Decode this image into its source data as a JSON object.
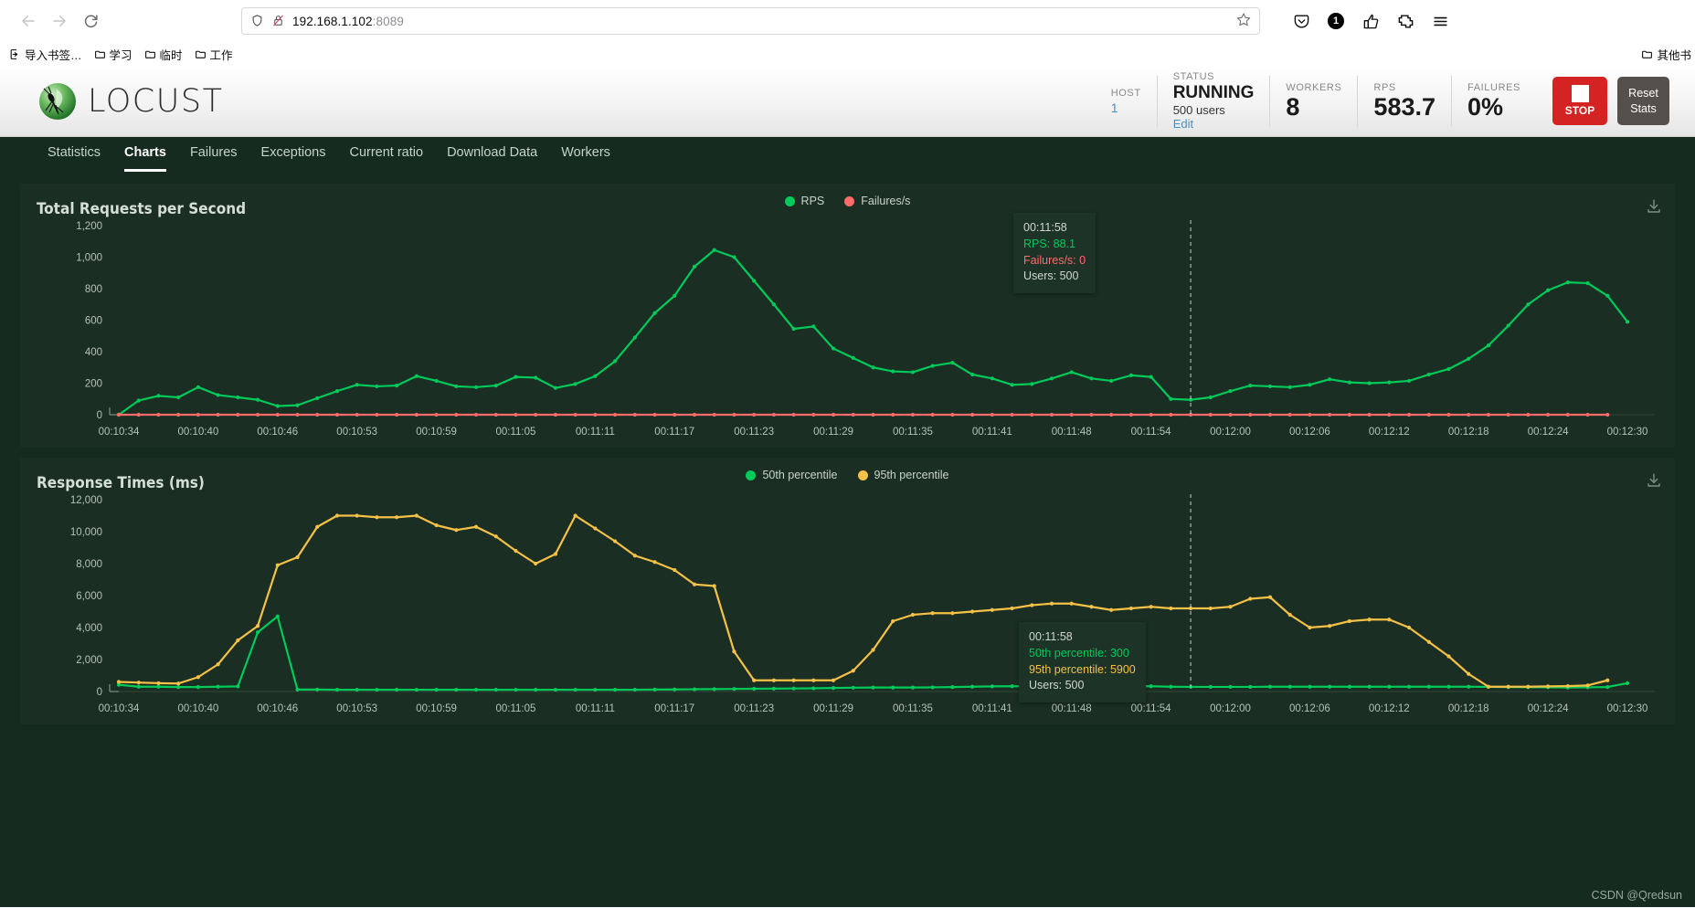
{
  "browser": {
    "back_icon": "back-arrow",
    "forward_icon": "forward-arrow",
    "reload_icon": "reload",
    "url": "192.168.1.102",
    "url_port": ":8089",
    "url_full": "192.168.1.102:8089",
    "bookmark_star": "star-icon",
    "toolbar_icons": [
      "pocket-icon",
      "notification-badge",
      "share-icon",
      "extensions-icon",
      "menu-icon"
    ],
    "notification_count": "1",
    "bookmarks": [
      {
        "label": "导入书签…",
        "icon": "import-bookmarks-icon"
      },
      {
        "label": "学习",
        "icon": "folder-icon"
      },
      {
        "label": "临时",
        "icon": "folder-icon"
      },
      {
        "label": "工作",
        "icon": "folder-icon"
      }
    ],
    "bookmarks_right": {
      "label": "其他书",
      "icon": "folder-icon"
    }
  },
  "header": {
    "brand": "LOCUST",
    "stats": [
      {
        "label": "HOST",
        "value": "1",
        "type": "link"
      },
      {
        "label": "STATUS",
        "value": "RUNNING",
        "sub": "500 users",
        "edit": "Edit"
      },
      {
        "label": "WORKERS",
        "value": "8"
      },
      {
        "label": "RPS",
        "value": "583.7"
      },
      {
        "label": "FAILURES",
        "value": "0%"
      }
    ],
    "stop_button": "STOP",
    "reset_button_line1": "Reset",
    "reset_button_line2": "Stats",
    "colors": {
      "stop": "#d32323",
      "reset": "#56504c",
      "link": "#4a90c4"
    }
  },
  "tabs": [
    {
      "label": "Statistics",
      "active": false
    },
    {
      "label": "Charts",
      "active": true
    },
    {
      "label": "Failures",
      "active": false
    },
    {
      "label": "Exceptions",
      "active": false
    },
    {
      "label": "Current ratio",
      "active": false
    },
    {
      "label": "Download Data",
      "active": false
    },
    {
      "label": "Workers",
      "active": false
    }
  ],
  "watermark": "CSDN @Qredsun",
  "download_icon": "download-icon",
  "chart_data": [
    {
      "type": "line",
      "title": "Total Requests per Second",
      "xlabel": "",
      "ylabel": "",
      "ylim": [
        0,
        1200
      ],
      "yticks": [
        0,
        200,
        400,
        600,
        800,
        1000,
        1200
      ],
      "ytick_labels": [
        "0",
        "200",
        "400",
        "600",
        "800",
        "1,000",
        "1,200"
      ],
      "grid": false,
      "legend_position": "top-center",
      "xtick_labels": [
        "00:10:34",
        "00:10:40",
        "00:10:46",
        "00:10:53",
        "00:10:59",
        "00:11:05",
        "00:11:11",
        "00:11:17",
        "00:11:23",
        "00:11:29",
        "00:11:35",
        "00:11:41",
        "00:11:48",
        "00:11:54",
        "00:12:00",
        "00:12:06",
        "00:12:12",
        "00:12:18",
        "00:12:24",
        "00:12:30"
      ],
      "series": [
        {
          "name": "RPS",
          "color": "#00ca5a",
          "values": [
            0,
            90,
            120,
            110,
            175,
            125,
            110,
            95,
            55,
            60,
            105,
            150,
            190,
            180,
            185,
            245,
            215,
            180,
            175,
            185,
            240,
            235,
            170,
            195,
            245,
            340,
            490,
            645,
            755,
            940,
            1045,
            1000,
            850,
            700,
            545,
            560,
            420,
            360,
            300,
            275,
            270,
            310,
            330,
            255,
            230,
            190,
            195,
            230,
            270,
            230,
            215,
            250,
            240,
            100,
            95,
            110,
            150,
            185,
            180,
            175,
            190,
            225,
            205,
            200,
            205,
            215,
            255,
            290,
            355,
            440,
            565,
            700,
            790,
            840,
            835,
            755,
            590
          ]
        },
        {
          "name": "Failures/s",
          "color": "#ff6b6b",
          "values": [
            0,
            0,
            0,
            0,
            0,
            0,
            0,
            0,
            0,
            0,
            0,
            0,
            0,
            0,
            0,
            0,
            0,
            0,
            0,
            0,
            0,
            0,
            0,
            0,
            0,
            0,
            0,
            0,
            0,
            0,
            0,
            0,
            0,
            0,
            0,
            0,
            0,
            0,
            0,
            0,
            0,
            0,
            0,
            0,
            0,
            0,
            0,
            0,
            0,
            0,
            0,
            0,
            0,
            0,
            0,
            0,
            0,
            0,
            0,
            0,
            0,
            0,
            0,
            0,
            0,
            0,
            0,
            0,
            0,
            0,
            0,
            0,
            0,
            0,
            0,
            0
          ]
        }
      ],
      "tooltip": {
        "time": "00:11:58",
        "lines": [
          {
            "text": "RPS: 88.1",
            "color": "#00ca5a"
          },
          {
            "text": "Failures/s: 0",
            "color": "#ff6b6b"
          }
        ],
        "users": "Users: 500"
      }
    },
    {
      "type": "line",
      "title": "Response Times (ms)",
      "xlabel": "",
      "ylabel": "",
      "ylim": [
        0,
        12000
      ],
      "yticks": [
        0,
        2000,
        4000,
        6000,
        8000,
        10000,
        12000
      ],
      "ytick_labels": [
        "0",
        "2,000",
        "4,000",
        "6,000",
        "8,000",
        "10,000",
        "12,000"
      ],
      "grid": false,
      "legend_position": "top-center",
      "xtick_labels": [
        "00:10:34",
        "00:10:40",
        "00:10:46",
        "00:10:53",
        "00:10:59",
        "00:11:05",
        "00:11:11",
        "00:11:17",
        "00:11:23",
        "00:11:29",
        "00:11:35",
        "00:11:41",
        "00:11:48",
        "00:11:54",
        "00:12:00",
        "00:12:06",
        "00:12:12",
        "00:12:18",
        "00:12:24",
        "00:12:30"
      ],
      "series": [
        {
          "name": "50th percentile",
          "color": "#00ca5a",
          "values": [
            420,
            300,
            300,
            280,
            280,
            300,
            320,
            3700,
            4700,
            120,
            120,
            110,
            110,
            110,
            110,
            110,
            110,
            110,
            110,
            110,
            110,
            110,
            110,
            110,
            110,
            110,
            110,
            120,
            130,
            140,
            150,
            160,
            170,
            180,
            190,
            200,
            220,
            240,
            250,
            250,
            250,
            260,
            280,
            300,
            320,
            330,
            330,
            330,
            340,
            340,
            340,
            330,
            330,
            300,
            290,
            290,
            290,
            290,
            300,
            300,
            300,
            300,
            300,
            300,
            300,
            300,
            300,
            300,
            300,
            290,
            280,
            270,
            260,
            250,
            260,
            280,
            520
          ]
        },
        {
          "name": "95th percentile",
          "color": "#f5c146",
          "values": [
            600,
            560,
            520,
            500,
            900,
            1700,
            3200,
            4100,
            7900,
            8400,
            10300,
            11000,
            11000,
            10900,
            10900,
            11000,
            10400,
            10100,
            10300,
            9700,
            8800,
            8000,
            8600,
            11000,
            10200,
            9400,
            8500,
            8100,
            7600,
            6700,
            6600,
            2500,
            700,
            700,
            700,
            700,
            700,
            1300,
            2600,
            4400,
            4800,
            4900,
            4900,
            5000,
            5100,
            5200,
            5400,
            5500,
            5500,
            5300,
            5100,
            5200,
            5300,
            5200,
            5200,
            5200,
            5300,
            5800,
            5900,
            4800,
            4000,
            4100,
            4400,
            4500,
            4500,
            4000,
            3100,
            2200,
            1100,
            300,
            300,
            300,
            320,
            340,
            380,
            700
          ]
        }
      ],
      "tooltip": {
        "time": "00:11:58",
        "lines": [
          {
            "text": "50th percentile: 300",
            "color": "#00ca5a"
          },
          {
            "text": "95th percentile: 5900",
            "color": "#f5c146"
          }
        ],
        "users": "Users: 500"
      }
    }
  ]
}
